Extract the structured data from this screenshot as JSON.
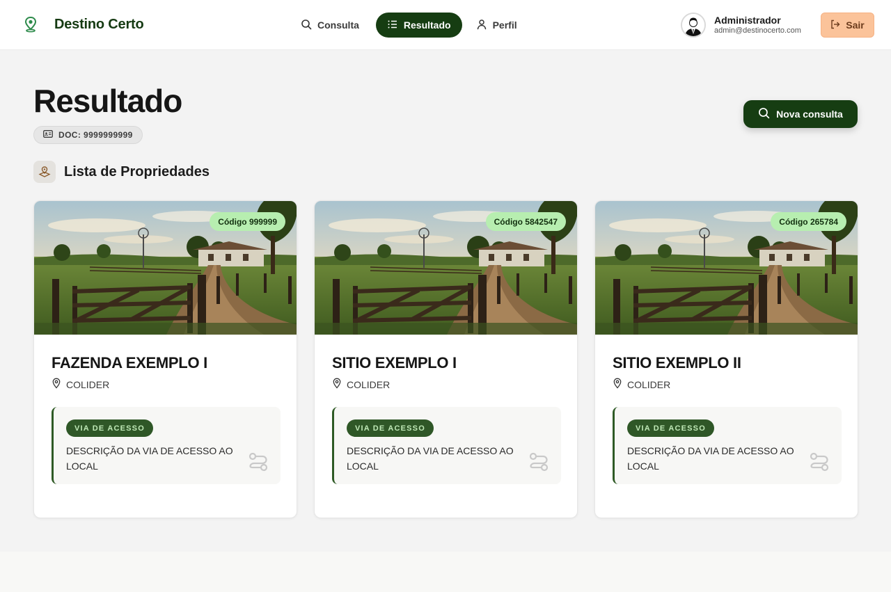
{
  "brand": {
    "name": "Destino Certo"
  },
  "nav": [
    {
      "label": "Consulta",
      "icon": "search-icon",
      "active": false
    },
    {
      "label": "Resultado",
      "icon": "list-icon",
      "active": true
    },
    {
      "label": "Perfil",
      "icon": "user-icon",
      "active": false
    }
  ],
  "user": {
    "name": "Administrador",
    "email": "admin@destinocerto.com"
  },
  "logout_label": "Sair",
  "page": {
    "title": "Resultado",
    "doc": "DOC: 9999999999",
    "new_query_label": "Nova consulta",
    "section_title": "Lista de Propriedades"
  },
  "cards": [
    {
      "code": "Código 999999",
      "title": "FAZENDA EXEMPLO I",
      "location": "COLIDER",
      "access_tag": "VIA DE ACESSO",
      "access_desc": "DESCRIÇÃO DA VIA DE ACESSO AO LOCAL"
    },
    {
      "code": "Código 5842547",
      "title": "SITIO EXEMPLO I",
      "location": "COLIDER",
      "access_tag": "VIA DE ACESSO",
      "access_desc": "DESCRIÇÃO DA VIA DE ACESSO AO LOCAL"
    },
    {
      "code": "Código 265784",
      "title": "SITIO EXEMPLO II",
      "location": "COLIDER",
      "access_tag": "VIA DE ACESSO",
      "access_desc": "DESCRIÇÃO DA VIA DE ACESSO AO LOCAL"
    }
  ],
  "colors": {
    "primary": "#163d12",
    "accent_badge": "#b7eeb0",
    "logout": "#fbc39a"
  }
}
